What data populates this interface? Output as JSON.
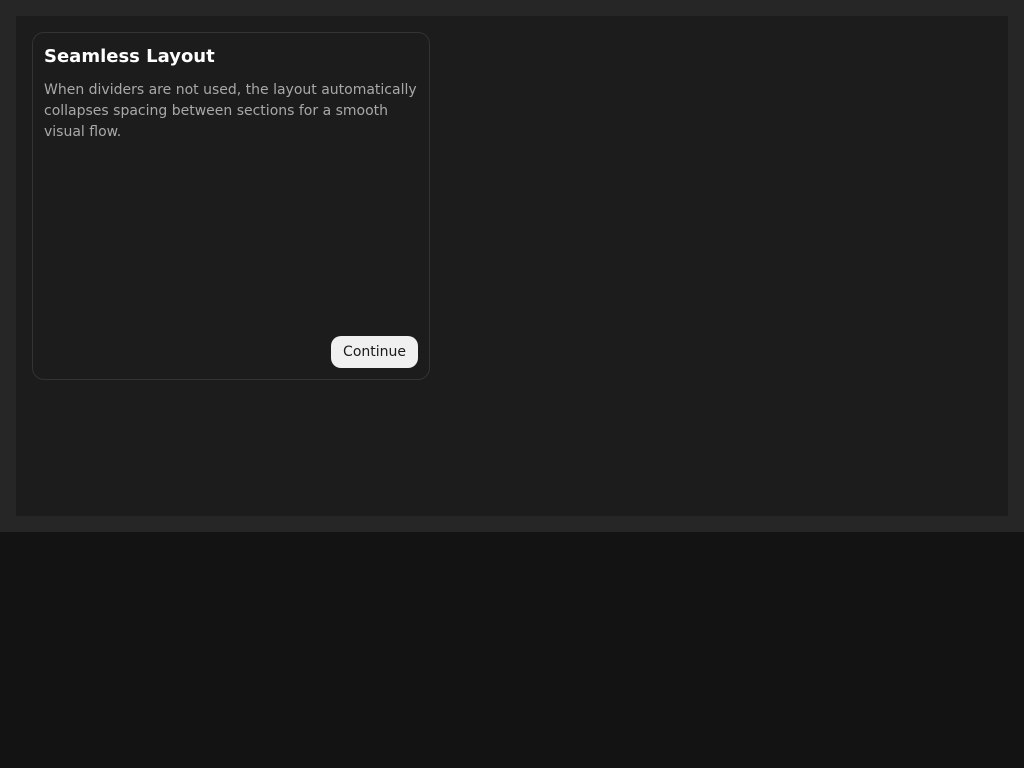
{
  "card": {
    "title": "Seamless Layout",
    "body": "When dividers are not used, the layout automatically collapses spacing between sections for a smooth visual flow.",
    "button_label": "Continue"
  },
  "colors": {
    "page_background": "#131313",
    "frame_background": "#262626",
    "canvas_background": "#1c1c1c",
    "card_border": "#333333",
    "title_text": "#ffffff",
    "body_text": "#a8a8a8",
    "button_background": "#f0f0f0",
    "button_text": "#1a1a1a"
  }
}
